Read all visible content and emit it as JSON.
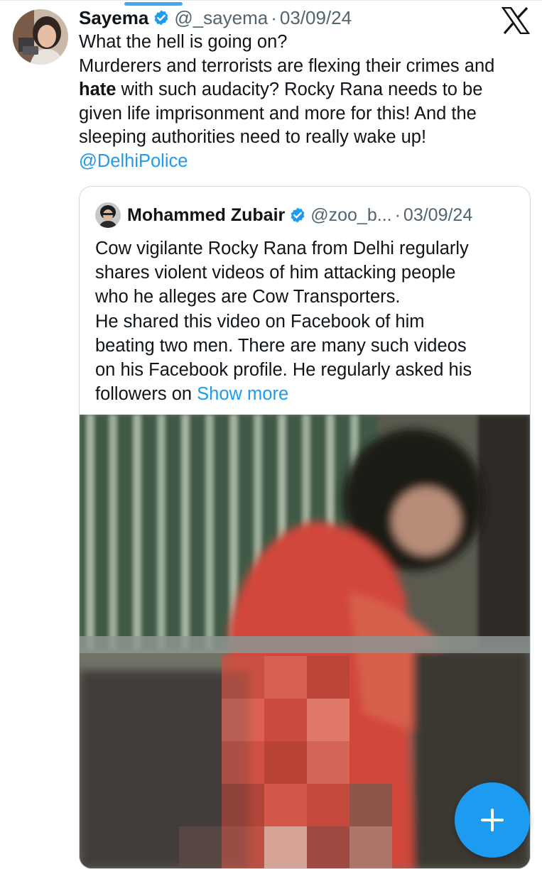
{
  "tweet": {
    "display_name": "Sayema",
    "handle": "@_sayema",
    "separator": "·",
    "date": "03/09/24",
    "lines": [
      "What the hell is going on?",
      "Murderers and terrorists are flexing their crimes and",
      "with such audacity? Rocky Rana needs to be",
      "given life imprisonment and more for this! And the",
      "sleeping authorities need to really wake up!"
    ],
    "bold_word": "hate",
    "mention": "@DelhiPolice"
  },
  "quoted": {
    "display_name": "Mohammed Zubair",
    "handle": "@zoo_b...",
    "separator": "·",
    "date": "03/09/24",
    "lines": [
      "Cow vigilante Rocky Rana from Delhi regularly",
      "shares violent videos of him attacking people",
      "who he alleges are Cow Transporters.",
      "He shared this video on Facebook of him",
      "beating two men. There are many such videos",
      "on his Facebook profile. He regularly asked his",
      "followers on"
    ],
    "show_more": "Show more"
  },
  "icons": {
    "verified": "verified-badge-icon",
    "brand": "x-logo-icon",
    "compose": "plus-icon"
  },
  "colors": {
    "accent": "#1d9bf0",
    "text": "#0f1419",
    "secondary": "#536471",
    "border": "#cfd9de"
  }
}
